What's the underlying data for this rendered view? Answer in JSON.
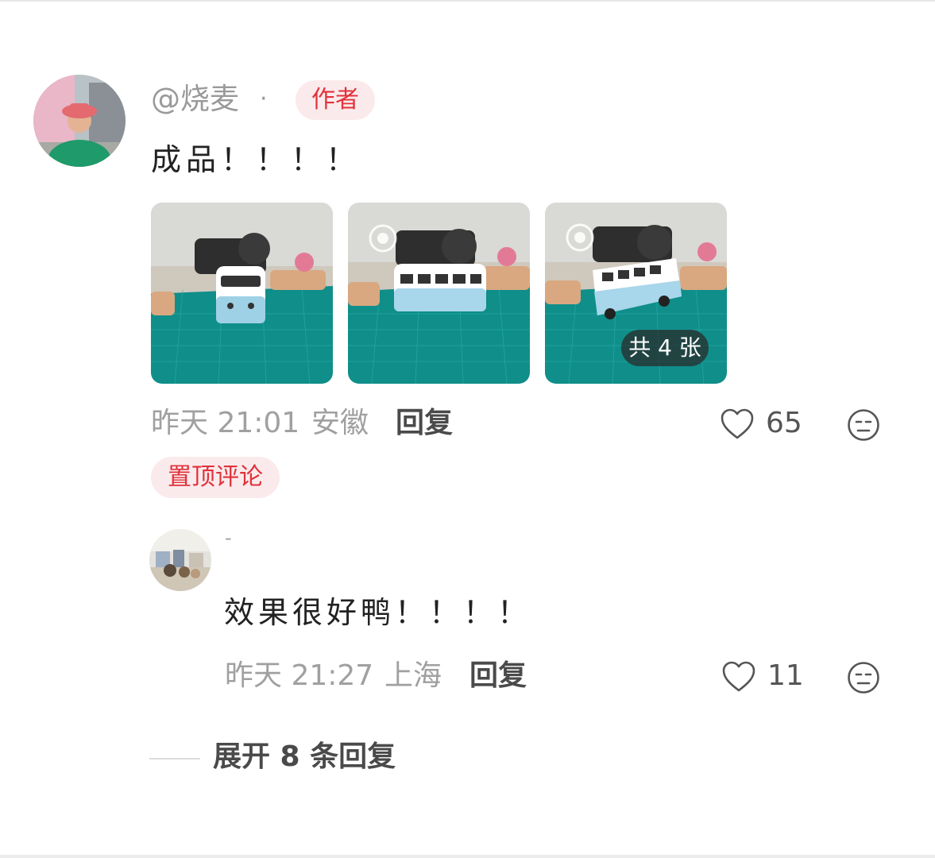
{
  "comment": {
    "username": "@烧麦",
    "separator": "·",
    "author_badge": "作者",
    "text": "成品！！！！",
    "images": [
      "bus-photo-1",
      "bus-photo-2",
      "bus-photo-3"
    ],
    "image_count_label": "共 4 张",
    "time": "昨天 21:01",
    "location": "安徽",
    "reply_label": "回复",
    "likes": "65",
    "pinned_badge": "置顶评论"
  },
  "reply": {
    "username": "-",
    "text": "效果很好鸭！！！！",
    "time": "昨天 21:27",
    "location": "上海",
    "reply_label": "回复",
    "likes": "11"
  },
  "expand": {
    "label": "展开 8 条回复"
  },
  "colors": {
    "accent_red": "#e0323b",
    "badge_bg": "#fbeaec",
    "mat_teal": "#0f8e8a"
  }
}
